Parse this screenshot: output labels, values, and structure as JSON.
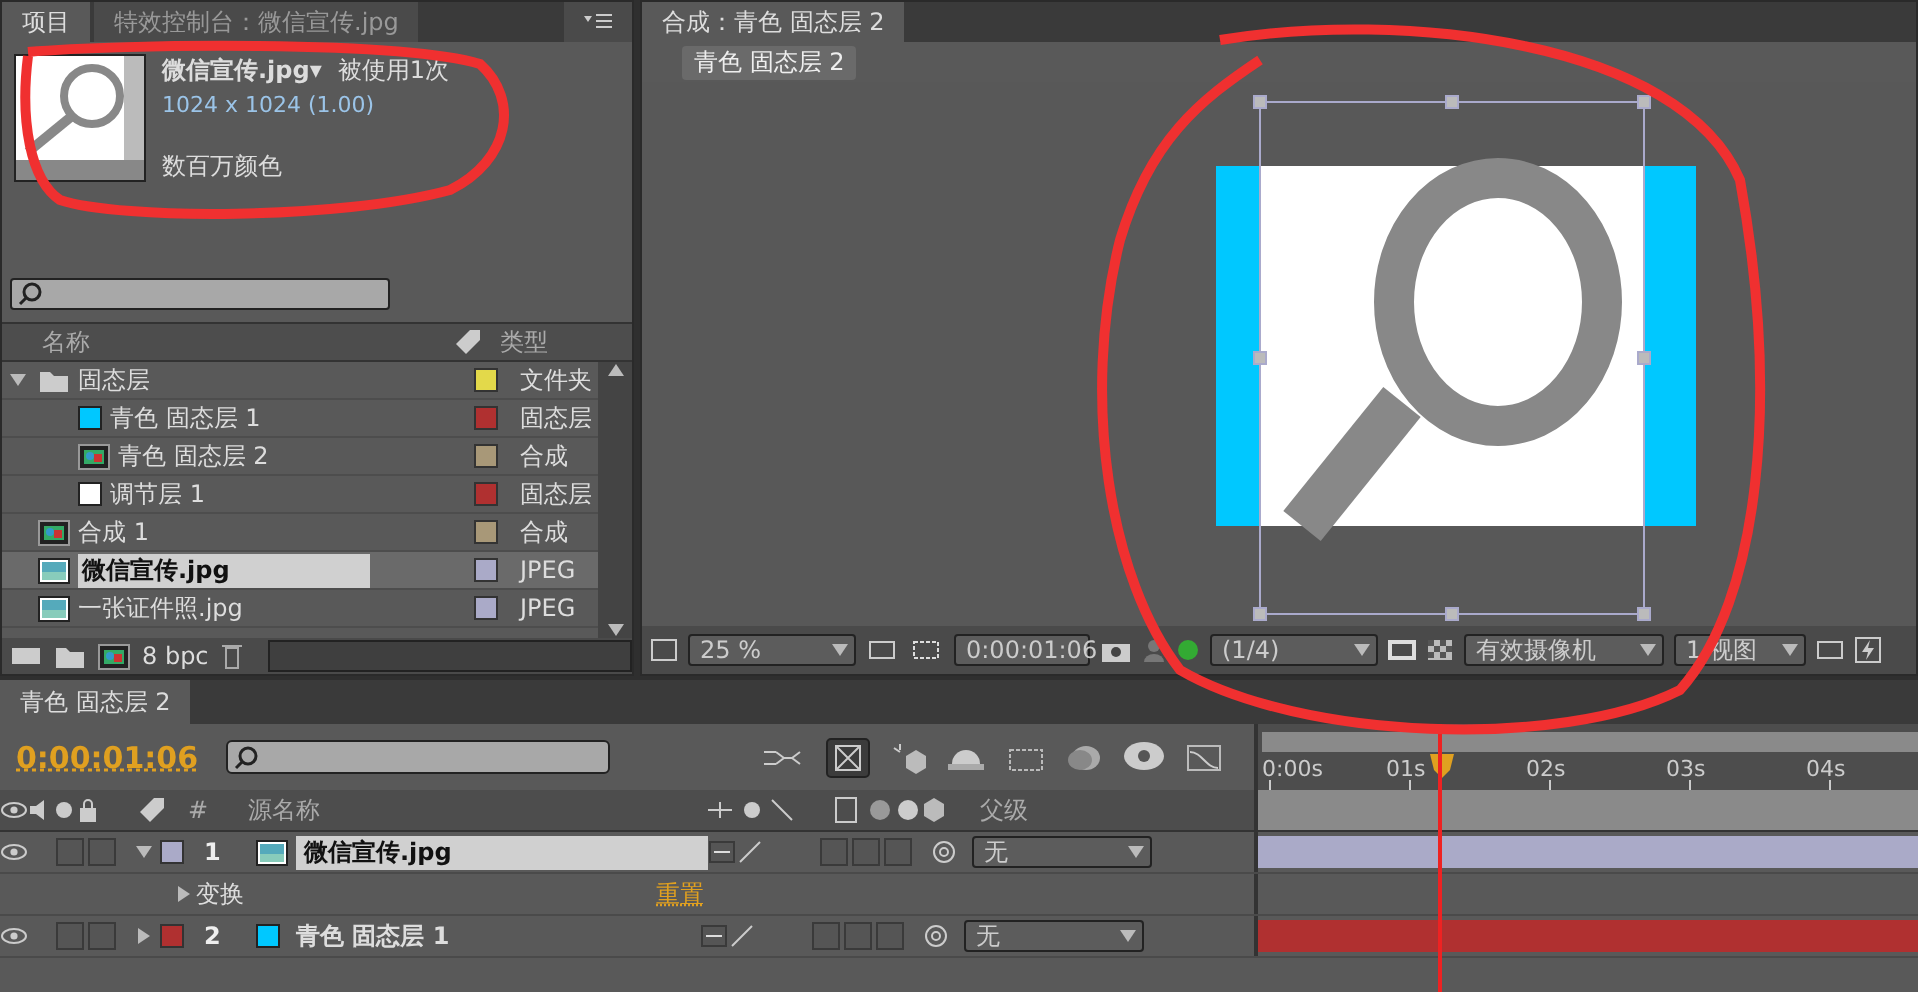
{
  "project_panel": {
    "tabs": [
      {
        "label": "项目",
        "selected": true
      },
      {
        "label": "特效控制台：微信宣传.jpg",
        "selected": false
      }
    ],
    "preview": {
      "name": "微信宣传.jpg▾",
      "usage": "被使用1次",
      "dimensions": "1024 x 1024 (1.00)",
      "colors": "数百万颜色"
    },
    "columns": {
      "name": "名称",
      "type": "类型"
    },
    "items": [
      {
        "name": "固态层",
        "kind": "folder",
        "color": "#e3d94a",
        "type": "文件夹",
        "selected": false,
        "expanded": true,
        "children": [
          {
            "name": "青色 固态层 1",
            "kind": "solid",
            "swatch": {
              "color": "#00c8ff"
            },
            "color": "#b03030",
            "type": "固态层",
            "selected": false
          },
          {
            "name": "青色 固态层 2",
            "kind": "comp",
            "color": "#a89878",
            "type": "合成",
            "selected": false
          },
          {
            "name": "调节层 1",
            "kind": "solid",
            "swatch": {
              "color": "#ffffff"
            },
            "color": "#b03030",
            "type": "固态层",
            "selected": false
          }
        ]
      },
      {
        "name": "合成 1",
        "kind": "comp",
        "color": "#a89878",
        "type": "合成",
        "selected": false
      },
      {
        "name": "微信宣传.jpg",
        "kind": "footage",
        "color": "#aaaac8",
        "type": "JPEG",
        "selected": true
      },
      {
        "name": "一张证件照.jpg",
        "kind": "footage",
        "color": "#aaaac8",
        "type": "JPEG",
        "selected": false
      }
    ],
    "footer": {
      "bit_depth": "8 bpc"
    }
  },
  "composition_panel": {
    "tab": "合成：青色 固态层 2",
    "breadcrumb": "青色 固态层 2",
    "toolbar": {
      "zoom": "25 %",
      "timecode": "0:00:01:06",
      "resolution": "(1/4)",
      "camera": "有效摄像机",
      "views": "1 视图"
    }
  },
  "timeline": {
    "tab": "青色 固态层 2",
    "timecode": "0:00:01:06",
    "columns": {
      "number": "#",
      "source_name": "源名称",
      "parent": "父级"
    },
    "ruler": [
      "0:00s",
      "01s",
      "02s",
      "03s",
      "04s"
    ],
    "layers": [
      {
        "number": "1",
        "name": "微信宣传.jpg",
        "kind": "footage",
        "color": "#aaaac8",
        "selected": true,
        "expanded": true,
        "parent": "无",
        "av_switches": [
          {
            "checked": false
          },
          {
            "checked": false
          }
        ],
        "layer_switches": [
          {
            "checked": false
          },
          {
            "checked": false
          },
          {
            "checked": false
          }
        ],
        "properties": [
          {
            "name": "变换",
            "action": "重置"
          }
        ]
      },
      {
        "number": "2",
        "name": "青色 固态层 1",
        "kind": "solid",
        "swatch": {
          "color": "#00c8ff"
        },
        "color": "#b03030",
        "selected": false,
        "expanded": false,
        "parent": "无",
        "av_switches": [
          {
            "checked": false
          },
          {
            "checked": false
          }
        ],
        "layer_switches": [
          {
            "checked": false
          },
          {
            "checked": false
          },
          {
            "checked": false
          }
        ]
      }
    ]
  }
}
